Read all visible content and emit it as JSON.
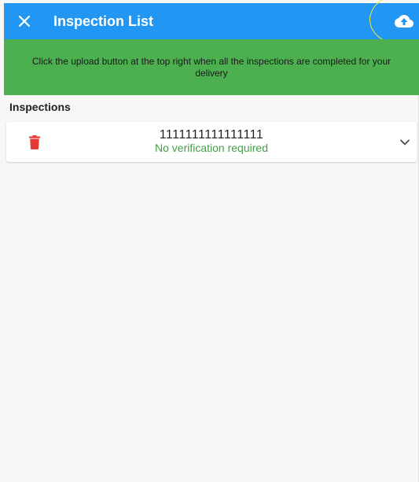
{
  "app_bar": {
    "title": "Inspection List",
    "close_icon": "close-icon",
    "upload_icon": "cloud-upload-icon",
    "color": "#2196f3"
  },
  "banner": {
    "message": "Click the upload button at the top right when all the inspections are completed for your delivery",
    "color": "#4caf50"
  },
  "section": {
    "heading": "Inspections"
  },
  "inspections": [
    {
      "id": "1111111111111111",
      "status": "No verification required",
      "status_color": "#43a047",
      "delete_icon": "trash-icon",
      "expand_icon": "chevron-down-icon",
      "delete_color": "#e53935"
    }
  ]
}
